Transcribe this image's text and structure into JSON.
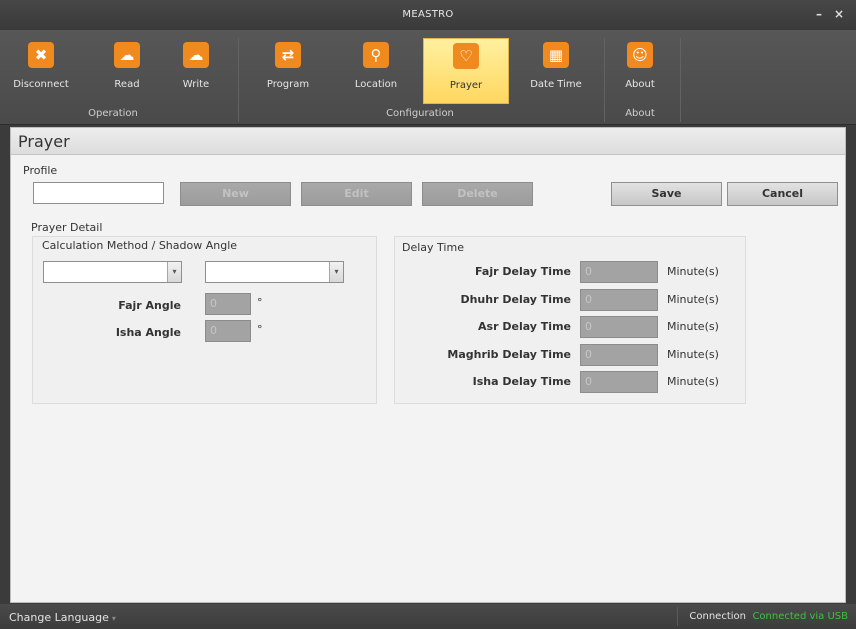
{
  "window": {
    "title": "MEASTRO",
    "minimize": "–",
    "close": "×"
  },
  "ribbon": {
    "buttons": [
      {
        "label": "Disconnect",
        "icon": "x-icon",
        "glyph": "✖"
      },
      {
        "label": "Read",
        "icon": "cloud-download-icon",
        "glyph": "☁"
      },
      {
        "label": "Write",
        "icon": "cloud-upload-icon",
        "glyph": "☁"
      },
      {
        "label": "Program",
        "icon": "program-flow-icon",
        "glyph": "⇄"
      },
      {
        "label": "Location",
        "icon": "location-pin-icon",
        "glyph": "⚲"
      },
      {
        "label": "Prayer",
        "icon": "prayer-hands-icon",
        "glyph": "♡"
      },
      {
        "label": "Date Time",
        "icon": "calendar-icon",
        "glyph": "▦"
      },
      {
        "label": "About",
        "icon": "people-icon",
        "glyph": "☺"
      }
    ],
    "groups": [
      "Operation",
      "Configuration",
      "About"
    ],
    "active": "Prayer",
    "accent": "#f08a1e",
    "active_bg": "#ffd760"
  },
  "page": {
    "title": "Prayer"
  },
  "profile": {
    "label": "Profile",
    "input_value": "",
    "new_label": "New",
    "edit_label": "Edit",
    "delete_label": "Delete",
    "save_label": "Save",
    "cancel_label": "Cancel"
  },
  "prayer_detail": {
    "label": "Prayer Detail",
    "calc_label": "Calculation Method / Shadow Angle",
    "method_value": "",
    "shadow_value": "",
    "fajr_angle_label": "Fajr Angle",
    "fajr_angle_value": "0",
    "isha_angle_label": "Isha Angle",
    "isha_angle_value": "0",
    "degree_symbol": "°"
  },
  "delay": {
    "label": "Delay Time",
    "unit": "Minute(s)",
    "rows": [
      {
        "label": "Fajr Delay Time",
        "value": "0"
      },
      {
        "label": "Dhuhr Delay Time",
        "value": "0"
      },
      {
        "label": "Asr Delay Time",
        "value": "0"
      },
      {
        "label": "Maghrib Delay Time",
        "value": "0"
      },
      {
        "label": "Isha Delay Time",
        "value": "0"
      }
    ]
  },
  "status": {
    "language_label": "Change Language",
    "connection_label": "Connection",
    "connection_value": "Connected via USB",
    "connection_color": "#3fc13f"
  }
}
